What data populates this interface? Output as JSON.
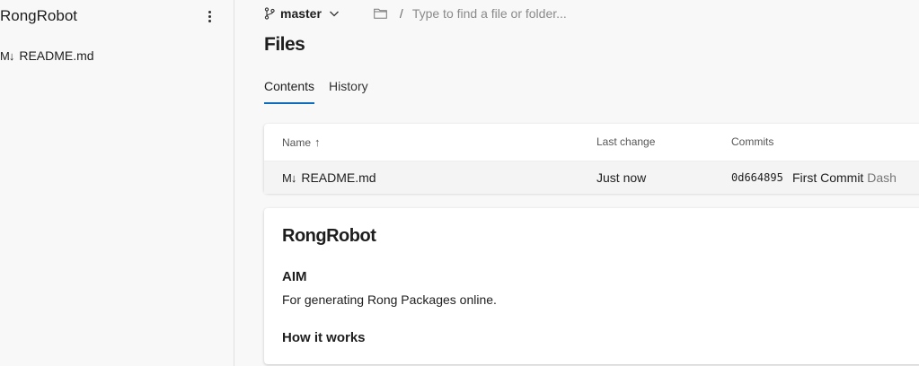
{
  "sidebar": {
    "repo_name": "RongRobot",
    "items": [
      {
        "icon": "markdown-icon",
        "icon_text": "M↓",
        "label": "README.md"
      }
    ]
  },
  "topbar": {
    "branch": "master",
    "path_separator": "/",
    "search_placeholder": "Type to find a file or folder..."
  },
  "page": {
    "title": "Files",
    "tabs": [
      {
        "label": "Contents",
        "active": true
      },
      {
        "label": "History",
        "active": false
      }
    ]
  },
  "files_table": {
    "columns": {
      "name": "Name",
      "sort_indicator": "↑",
      "last_change": "Last change",
      "commits": "Commits"
    },
    "rows": [
      {
        "icon_text": "M↓",
        "name": "README.md",
        "last_change": "Just now",
        "commit_hash": "0d664895",
        "commit_message": "First Commit",
        "commit_author": "Dash"
      }
    ]
  },
  "readme": {
    "title": "RongRobot",
    "section1_heading": "AIM",
    "section1_text": "For generating Rong Packages online.",
    "section2_heading": "How it works"
  },
  "colors": {
    "accent": "#0f6cbd",
    "background": "#f8f8f8"
  }
}
